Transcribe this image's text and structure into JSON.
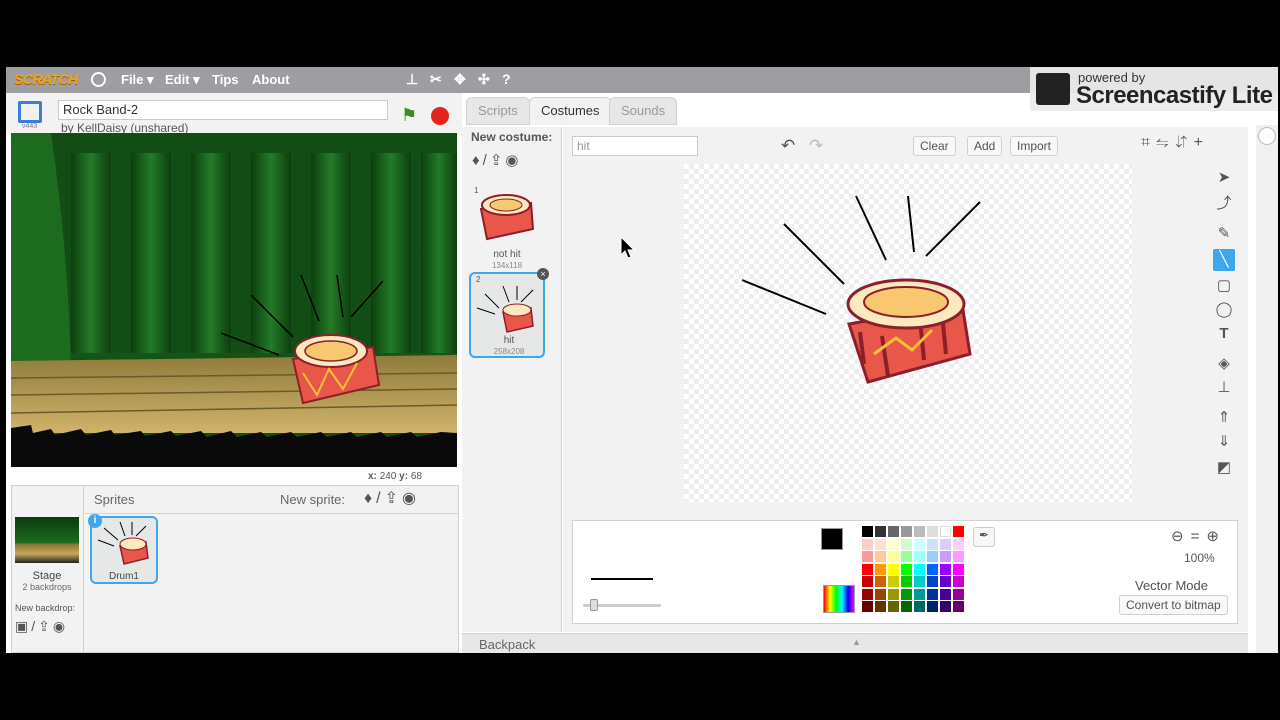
{
  "menu": {
    "logo": "SCRATCH",
    "items": [
      "File",
      "Edit",
      "Tips",
      "About"
    ],
    "tool_icons": [
      "duplicate-icon",
      "delete-icon",
      "grow-icon",
      "shrink-icon",
      "help-icon"
    ]
  },
  "watermark": {
    "powered_by": "powered by",
    "name": "Screencastify Lite"
  },
  "project": {
    "title": "Rock Band-2",
    "author": "by KellDaisy (unshared)",
    "version": "v443"
  },
  "stage": {
    "coords_x_label": "x:",
    "coords_x": "240",
    "coords_y_label": "y:",
    "coords_y": "68"
  },
  "sprites_panel": {
    "title": "Sprites",
    "new_sprite": "New sprite:",
    "stage_label": "Stage",
    "backdrops": "2 backdrops",
    "new_backdrop": "New backdrop:",
    "sprites": [
      {
        "name": "Drum1",
        "selected": true
      }
    ]
  },
  "tabs": [
    "Scripts",
    "Costumes",
    "Sounds"
  ],
  "active_tab": "Costumes",
  "costumes": {
    "new_costume": "New costume:",
    "items": [
      {
        "num": "1",
        "name": "not hit",
        "size": "134x118"
      },
      {
        "num": "2",
        "name": "hit",
        "size": "258x208"
      }
    ]
  },
  "editor": {
    "costume_name": "hit",
    "clear": "Clear",
    "add": "Add",
    "import": "Import",
    "zoom": "100%",
    "mode": "Vector Mode",
    "convert": "Convert to bitmap",
    "primary_color": "#000000",
    "selected_tool": "line-tool"
  },
  "backpack": "Backpack",
  "palette": [
    [
      "#000000",
      "#333333",
      "#666666",
      "#999999",
      "#bbbbbb",
      "#dddddd",
      "#ffffff",
      "#ff0000"
    ],
    [
      "#ffcccc",
      "#ffe0cc",
      "#ffffcc",
      "#ccffcc",
      "#ccffff",
      "#cce0ff",
      "#ddccff",
      "#ffccff"
    ],
    [
      "#ff9999",
      "#ffcc99",
      "#ffff99",
      "#99ff99",
      "#99ffff",
      "#99ccff",
      "#cc99ff",
      "#ff99ff"
    ],
    [
      "#ff0000",
      "#ff9900",
      "#ffff00",
      "#00ff00",
      "#00ffff",
      "#0066ff",
      "#9900ff",
      "#ff00ff"
    ],
    [
      "#cc0000",
      "#cc6600",
      "#cccc00",
      "#00cc00",
      "#00cccc",
      "#0044cc",
      "#6600cc",
      "#cc00cc"
    ],
    [
      "#990000",
      "#994400",
      "#999900",
      "#009900",
      "#009999",
      "#003399",
      "#440099",
      "#990099"
    ],
    [
      "#660000",
      "#663300",
      "#666600",
      "#006600",
      "#006666",
      "#002266",
      "#330066",
      "#660066"
    ]
  ]
}
